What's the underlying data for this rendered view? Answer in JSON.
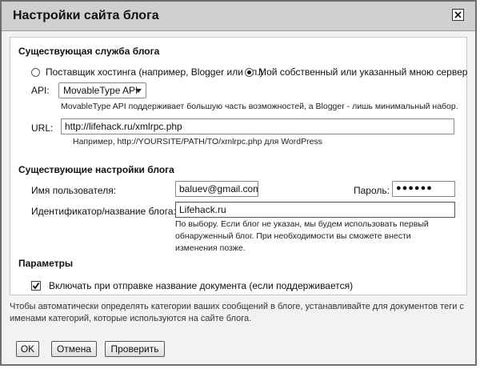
{
  "dialog": {
    "title": "Настройки сайта блога",
    "close_icon": "close-icon"
  },
  "existing_service": {
    "heading": "Существующая служба блога",
    "radio_hosting_label": "Поставщик хостинга (например, Blogger или т.п.)",
    "radio_hosting_selected": false,
    "radio_own_label": "Мой собственный или указанный мною сервер",
    "radio_own_selected": true,
    "api_label": "API:",
    "api_value": "MovableType API",
    "api_hint": "MovableType API поддерживает большую часть возможностей, а Blogger - лишь минимальный набор.",
    "url_label": "URL:",
    "url_value": "http://lifehack.ru/xmlrpc.php",
    "url_hint": "Например, http://YOURSITE/PATH/TO/xmlrpc.php для WordPress"
  },
  "blog_settings": {
    "heading": "Существующие настройки блога",
    "username_label": "Имя пользователя:",
    "username_value": "baluev@gmail.com",
    "password_label": "Пароль:",
    "password_value": "●●●●●●",
    "blog_id_label": "Идентификатор/название блога:",
    "blog_id_value": "Lifehack.ru",
    "blog_id_hint": "По выбору. Если блог не указан, мы будем использовать первый обнаруженный блог. При необходимости вы сможете внести изменения позже."
  },
  "params": {
    "heading": "Параметры",
    "include_title_label": "Включать при отправке название документа (если поддерживается)",
    "include_title_checked": true
  },
  "info_text": "Чтобы автоматически определять категории ваших сообщений в блоге, устанавливайте для документов теги с именами категорий, которые используются на сайте блога.",
  "buttons": {
    "ok": "OK",
    "cancel": "Отмена",
    "verify": "Проверить"
  }
}
